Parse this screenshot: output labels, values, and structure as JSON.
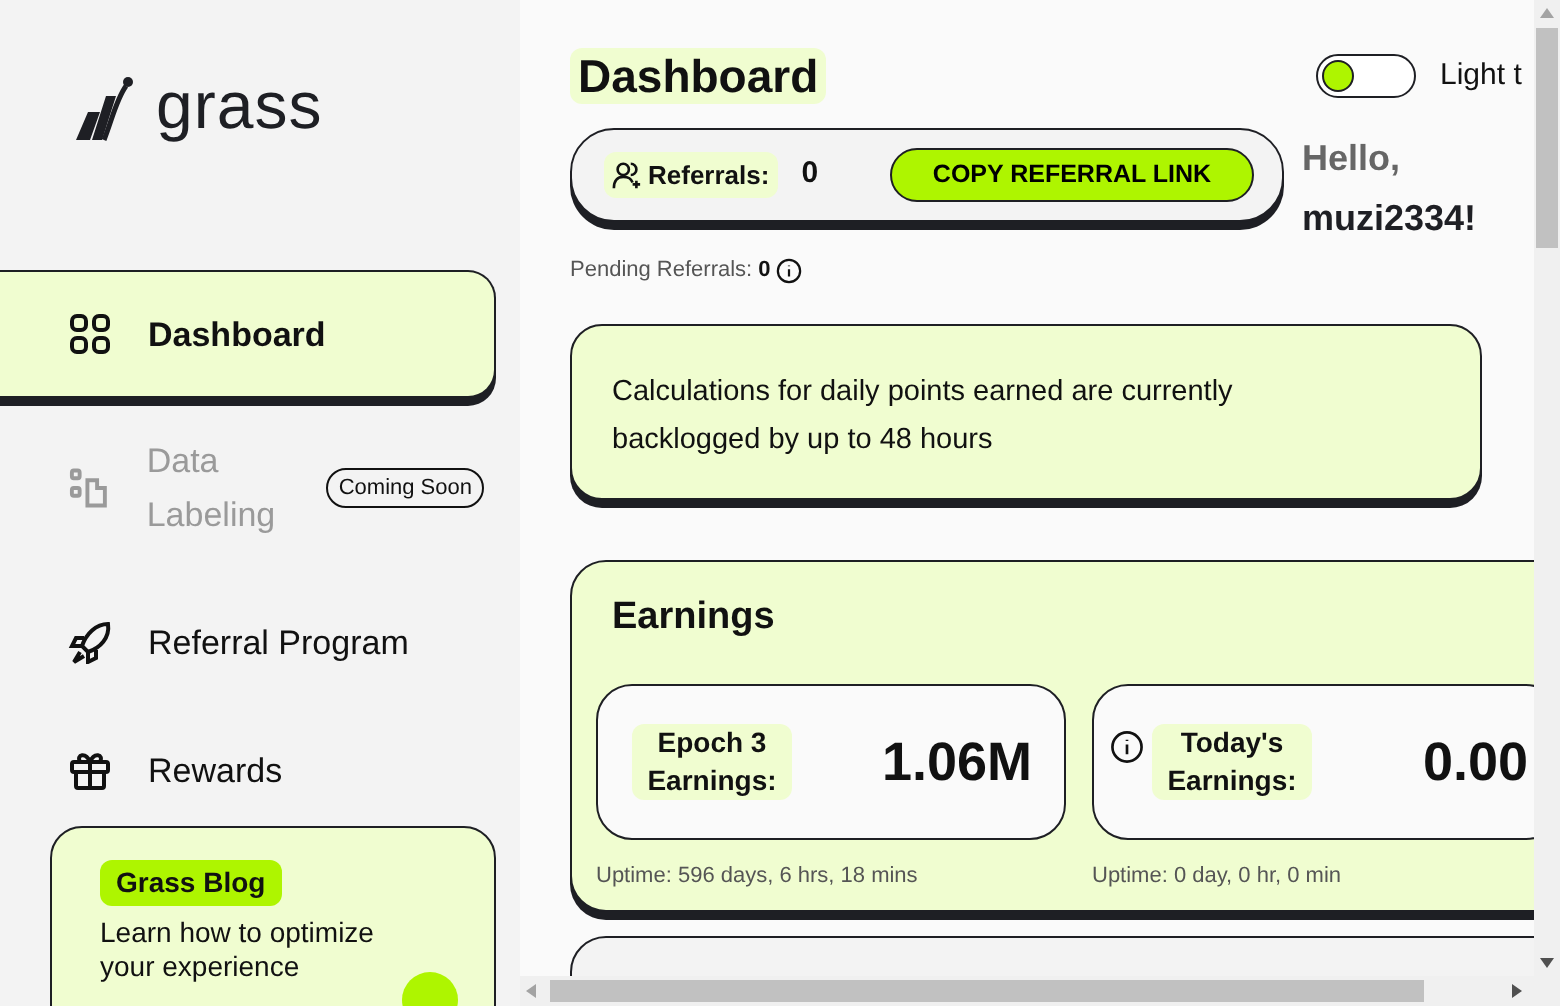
{
  "brand": {
    "name": "grass"
  },
  "sidebar": {
    "items": [
      {
        "label": "Dashboard",
        "kind": "grid",
        "selected": true,
        "disabled": false
      },
      {
        "label": "Data Labeling",
        "kind": "labeling",
        "selected": false,
        "disabled": true,
        "badge": "Coming Soon"
      },
      {
        "label": "Referral Program",
        "kind": "rocket",
        "selected": false,
        "disabled": false
      },
      {
        "label": "Rewards",
        "kind": "gift",
        "selected": false,
        "disabled": false
      }
    ],
    "blog": {
      "tag": "Grass Blog",
      "text": "Learn how to optimize your experience"
    }
  },
  "header": {
    "title": "Dashboard",
    "theme_toggle": {
      "on": false,
      "label": "Light t"
    }
  },
  "referrals": {
    "label": "Referrals:",
    "count": "0",
    "button": "COPY REFERRAL LINK",
    "pending_label": "Pending Referrals:",
    "pending_count": "0"
  },
  "greeting": {
    "hello": "Hello,",
    "user": "muzi2334!"
  },
  "notice": "Calculations for daily points earned are currently backlogged by up to 48 hours",
  "earnings": {
    "title": "Earnings",
    "cards": [
      {
        "label": "Epoch 3 Earnings:",
        "value": "1.06M",
        "info": false,
        "uptime": "Uptime: 596 days, 6 hrs, 18 mins"
      },
      {
        "label": "Today's Earnings:",
        "value": "0.00",
        "info": true,
        "uptime": "Uptime: 0 day, 0 hr, 0 min"
      }
    ]
  }
}
